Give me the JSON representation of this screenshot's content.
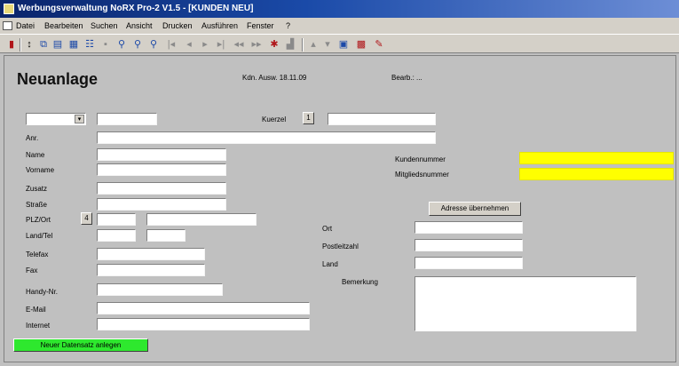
{
  "window": {
    "title": "Werbungsverwaltung NoRX Pro-2 V1.5 - [KUNDEN NEU]"
  },
  "menubar": {
    "items": [
      "Datei",
      "Bearbeiten",
      "Suchen",
      "Ansicht",
      "Drucken",
      "Ausführen",
      "Fenster",
      "?"
    ]
  },
  "toolbar": {
    "icons": [
      "book-icon",
      "sort-icon",
      "copy-icon",
      "paste-icon",
      "grid-icon",
      "table-icon",
      "save-icon",
      "search-icon",
      "search-next-icon",
      "search-all-icon",
      "first-record-icon",
      "prev-record-icon",
      "next-record-icon",
      "last-record-icon",
      "prev-page-icon",
      "next-page-icon",
      "new-record-icon",
      "delete-record-icon",
      "up-icon",
      "down-icon",
      "image-icon",
      "chart-icon",
      "tools-icon"
    ]
  },
  "form": {
    "heading": "Neuanlage",
    "header_text_1": "Kdn. Ausw. 18.11.09",
    "header_text_2": "Bearb.: ...",
    "combo_first": "",
    "kuerzel_label": "Kuerzel",
    "labels_left": {
      "anrede": "Anr.",
      "name": "Name",
      "vorname": "Vorname",
      "zusatz": "Zusatz",
      "strasse": "Straße",
      "plz_ort": "PLZ/Ort",
      "land_tel": "Land/Tel",
      "telefon": "Telefax",
      "fax": "Fax",
      "handy": "Handy-Nr.",
      "email": "E-Mail",
      "internet": "Internet"
    },
    "labels_right": {
      "kundennummer": "Kundennummer",
      "mitgliedsnummer": "Mitgliedsnummer",
      "ort": "Ort",
      "postleitzahl": "Postleitzahl",
      "land": "Land",
      "bemerkung": "Bemerkung"
    },
    "buttons": {
      "adresse": "Adresse übernehmen",
      "plz_btn": "4",
      "kuerzel_btn": "1"
    },
    "footer_button": "Neuer Datensatz anlegen"
  },
  "colors": {
    "highlight": "#ffff00",
    "footer_button": "#2ee82e",
    "titlebar": "#0a246a"
  }
}
